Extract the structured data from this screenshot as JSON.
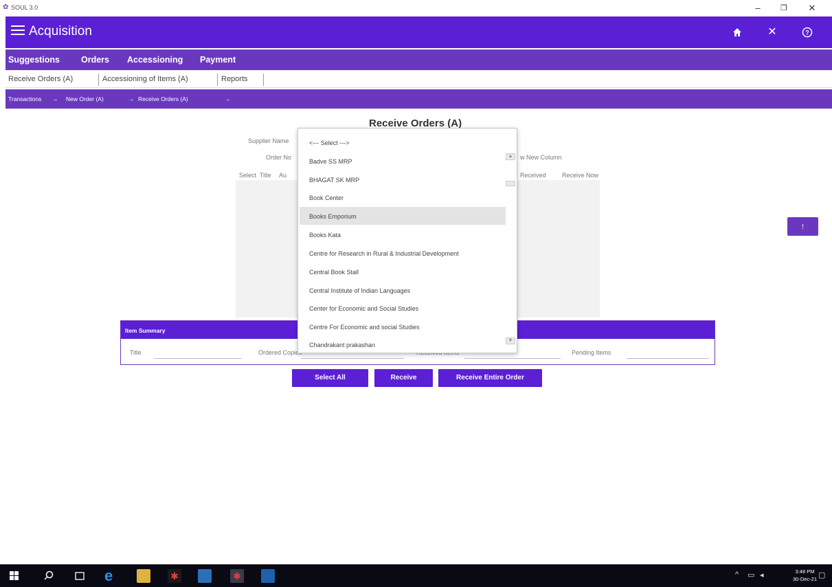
{
  "window": {
    "title": "SOUL 3.0",
    "minimize_glyph": "–",
    "maximize_glyph": "❐",
    "close_glyph": "✕"
  },
  "header": {
    "app_name": "Acquisition",
    "home_glyph": "⌂",
    "close_glyph": "✕",
    "help_glyph": "?"
  },
  "main_menu": [
    "Suggestions",
    "Orders",
    "Accessioning",
    "Payment"
  ],
  "sub_tabs": [
    "Receive Orders (A)",
    "Accessioning of Items (A)",
    "Reports"
  ],
  "breadcrumb": [
    "Transactions",
    "→",
    "New Order (A)",
    "→",
    "Receive Orders (A)",
    "→"
  ],
  "page": {
    "title": "Receive Orders (A)",
    "supplier_label": "Supplier Name",
    "order_label": "Order No",
    "new_column_label": "w New Column",
    "grid_headers": [
      "Select",
      "Title",
      "Au",
      "Received",
      "Receive Now"
    ]
  },
  "dropdown": {
    "items": [
      "<--- Select --->",
      "Badve SS MRP",
      "BHAGAT SK MRP",
      "Book Center",
      "Books Emporium",
      "Books Kata",
      "Centre for Research in Rural & Industrial Development",
      "Central Book Stall",
      "Central Institute of Indian Languages",
      "Center for Economic and Social Studies",
      "Centre For Economic and social Studies",
      "Chandrakant prakashan"
    ],
    "highlighted_index": 4
  },
  "summary": {
    "heading": "Item Summary",
    "title_label": "Title",
    "ordered_label": "Ordered Copies",
    "received_label": "Received Items",
    "pending_label": "Pending Items"
  },
  "buttons": {
    "select_all": "Select All",
    "receive": "Receive",
    "receive_entire": "Receive Entire Order",
    "scroll_top_glyph": "↑"
  },
  "taskbar": {
    "time": "3:48 PM",
    "date": "30-Dec-21"
  },
  "colors": {
    "header": "#5b1fd6",
    "menu": "#6a38bf",
    "taskbar": "#0a0a14"
  }
}
